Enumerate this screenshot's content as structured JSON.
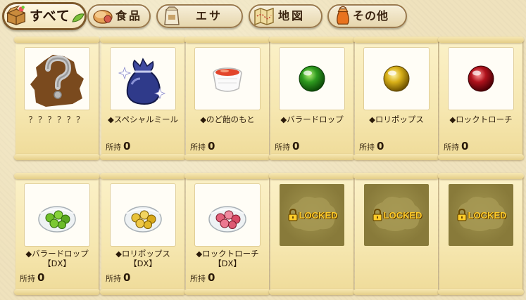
{
  "tabs": [
    {
      "label": "すべて",
      "icon": "box-icon",
      "active": true
    },
    {
      "label": "食品",
      "icon": "bread-icon",
      "active": false
    },
    {
      "label": "エサ",
      "icon": "feed-bag-icon",
      "active": false
    },
    {
      "label": "地図",
      "icon": "map-icon",
      "active": false
    },
    {
      "label": "その他",
      "icon": "pouch-icon",
      "active": false
    }
  ],
  "owned_label": "所持",
  "locked_label": "LOCKED",
  "items": [
    {
      "name": "？？？？？？",
      "icon": "question-mark-icon",
      "count": null
    },
    {
      "name": "◆スペシャルミール",
      "icon": "sack-icon",
      "count": "0"
    },
    {
      "name": "◆のど飴のもと",
      "icon": "cup-icon",
      "count": "0"
    },
    {
      "name": "◆バラードロップ",
      "icon": "green-orb-icon",
      "count": "0"
    },
    {
      "name": "◆ロリポップス",
      "icon": "yellow-orb-icon",
      "count": "0"
    },
    {
      "name": "◆ロックトローチ",
      "icon": "red-orb-icon",
      "count": "0"
    },
    {
      "name": "◆バラードロップ【DX】",
      "icon": "green-candy-bowl-icon",
      "count": "0"
    },
    {
      "name": "◆ロリポップス【DX】",
      "icon": "yellow-candy-bowl-icon",
      "count": "0"
    },
    {
      "name": "◆ロックトローチ【DX】",
      "icon": "red-candy-bowl-icon",
      "count": "0"
    }
  ],
  "colors": {
    "orb_green": "#2e9b1f",
    "orb_yellow": "#d8b018",
    "orb_red": "#b0121c",
    "lock_text": "#ffcc2a"
  }
}
